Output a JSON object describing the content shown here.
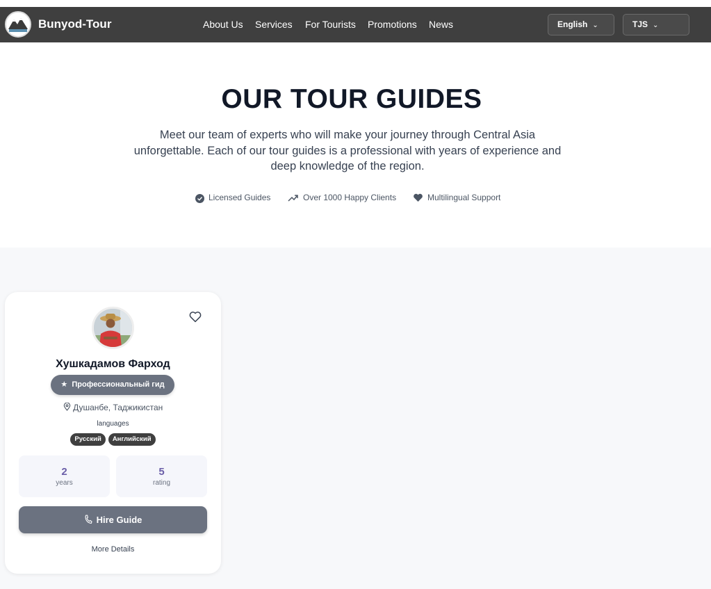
{
  "header": {
    "brand": "Bunyod-Tour",
    "nav": [
      "About Us",
      "Services",
      "For Tourists",
      "Promotions",
      "News"
    ],
    "language": "English",
    "currency": "TJS"
  },
  "hero": {
    "title": "OUR TOUR GUIDES",
    "description": "Meet our team of experts who will make your journey through Central Asia unforgettable. Each of our tour guides is a professional with years of experience and deep knowledge of the region.",
    "features": [
      {
        "icon": "check-badge-icon",
        "label": "Licensed Guides"
      },
      {
        "icon": "trending-up-icon",
        "label": "Over 1000 Happy Clients"
      },
      {
        "icon": "heart-icon",
        "label": "Multilingual Support"
      }
    ]
  },
  "guide_card": {
    "name": "Хушкадамов Фарход",
    "badge": "Профессиональный гид",
    "location": "Душанбе, Таджикистан",
    "languages_title": "languages",
    "languages": [
      "Русский",
      "Английский"
    ],
    "experience": {
      "value": "2",
      "unit": "years"
    },
    "rating": {
      "value": "5",
      "unit": "rating"
    },
    "hire_label": "Hire Guide",
    "more_label": "More Details"
  },
  "colors": {
    "nav_bg": "#3f3f3f",
    "accent_gray": "#6b7280",
    "stat_value": "#6b5fa8",
    "section_bg": "#f7f8fa"
  }
}
